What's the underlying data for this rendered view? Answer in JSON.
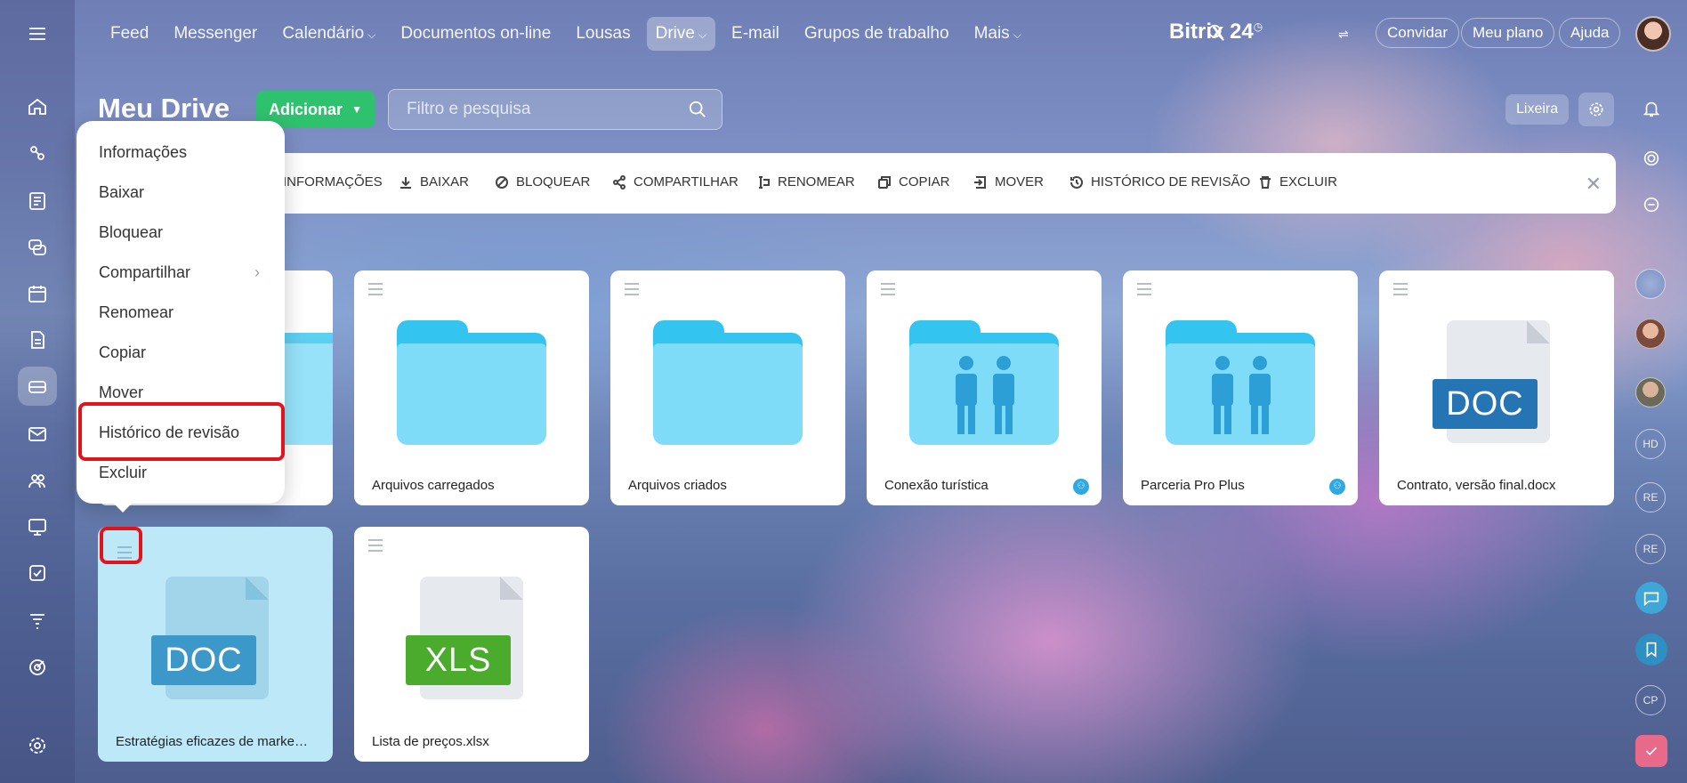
{
  "nav": {
    "items": [
      "Feed",
      "Messenger",
      "Calendário",
      "Documentos on-line",
      "Lousas",
      "Drive",
      "E-mail",
      "Grupos de trabalho",
      "Mais"
    ],
    "brand": "Bitrix",
    "brand_num": "24",
    "invite": "Convidar",
    "plan": "Meu plano",
    "help": "Ajuda"
  },
  "header": {
    "title": "Meu Drive",
    "add_label": "Adicionar",
    "search_placeholder": "Filtro e pesquisa",
    "trash_label": "Lixeira"
  },
  "actions": [
    "INFORMAÇÕES",
    "BAIXAR",
    "BLOQUEAR",
    "COMPARTILHAR",
    "RENOMEAR",
    "COPIAR",
    "MOVER",
    "HISTÓRICO DE REVISÃO",
    "EXCLUIR"
  ],
  "menu": {
    "items": [
      "Informações",
      "Baixar",
      "Bloquear",
      "Compartilhar",
      "Renomear",
      "Copiar",
      "Mover",
      "Histórico de revisão",
      "Excluir"
    ]
  },
  "cards": [
    {
      "name": "Arquivos carregados",
      "type": "folder"
    },
    {
      "name": "Arquivos criados",
      "type": "folder"
    },
    {
      "name": "Conexão turística",
      "type": "shared-folder"
    },
    {
      "name": "Parceria Pro Plus",
      "type": "shared-folder"
    },
    {
      "name": "Contrato, versão final.docx",
      "type": "doc",
      "label": "DOC"
    },
    {
      "name": "Estratégias eficazes de marketin...",
      "type": "doc",
      "label": "DOC"
    },
    {
      "name": "Lista de preços.xlsx",
      "type": "xls",
      "label": "XLS"
    }
  ],
  "right_rail": {
    "avatars": [
      "HD",
      "RE",
      "RE",
      "CP"
    ]
  },
  "colors": {
    "add_button": "#2fc26e",
    "highlight": "#e3131c",
    "folder": "#7edcf8",
    "doc_label": "#2574b4",
    "xls_label": "#4aab2c"
  }
}
